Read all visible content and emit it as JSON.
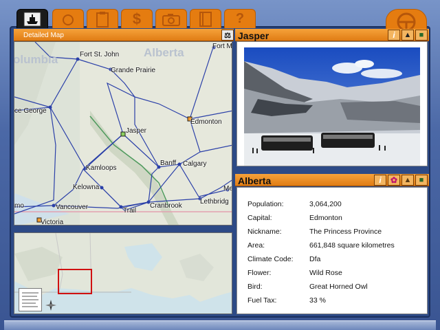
{
  "tabs": [
    {
      "name": "ship-wheel-tab",
      "icon": "ferry-icon"
    },
    {
      "name": "camera-tab",
      "icon": "camera-icon"
    },
    {
      "name": "clipboard-tab",
      "icon": "clipboard-icon"
    },
    {
      "name": "money-tab",
      "icon": "dollar-icon"
    },
    {
      "name": "photo-tab",
      "icon": "camera-icon"
    },
    {
      "name": "notebook-tab",
      "icon": "notebook-icon"
    },
    {
      "name": "help-tab",
      "icon": "question-icon"
    }
  ],
  "detail_map": {
    "title": "Detailed Map",
    "region_labels": [
      "Alberta",
      "olumbia"
    ],
    "cities": [
      "Fort St. John",
      "Grande Prairie",
      "Fort M",
      "ce George",
      "Jasper",
      "Edmonton",
      "Banff",
      "Calgary",
      "Kamloops",
      "Kelowna",
      "Vancouver",
      "Trail",
      "Cranbrook",
      "Lethbridg",
      "Me",
      "mo",
      "Victoria"
    ]
  },
  "photo_panel": {
    "title": "Jasper"
  },
  "info_panel": {
    "title": "Alberta",
    "rows": [
      {
        "label": "Population:",
        "value": "3,064,200"
      },
      {
        "label": "Capital:",
        "value": "Edmonton"
      },
      {
        "label": "Nickname:",
        "value": "The Princess Province"
      },
      {
        "label": "Area:",
        "value": "661,848 square kilometres"
      },
      {
        "label": "Climate Code:",
        "value": "Dfa"
      },
      {
        "label": "Flower:",
        "value": "Wild Rose"
      },
      {
        "label": "Bird:",
        "value": "Great Horned Owl"
      },
      {
        "label": "Fuel Tax:",
        "value": "33 %"
      }
    ]
  },
  "colors": {
    "accent_orange": "#e57c10",
    "frame_blue": "#3a5592",
    "road_blue": "#2a3fa8",
    "selection_red": "#d01010"
  }
}
